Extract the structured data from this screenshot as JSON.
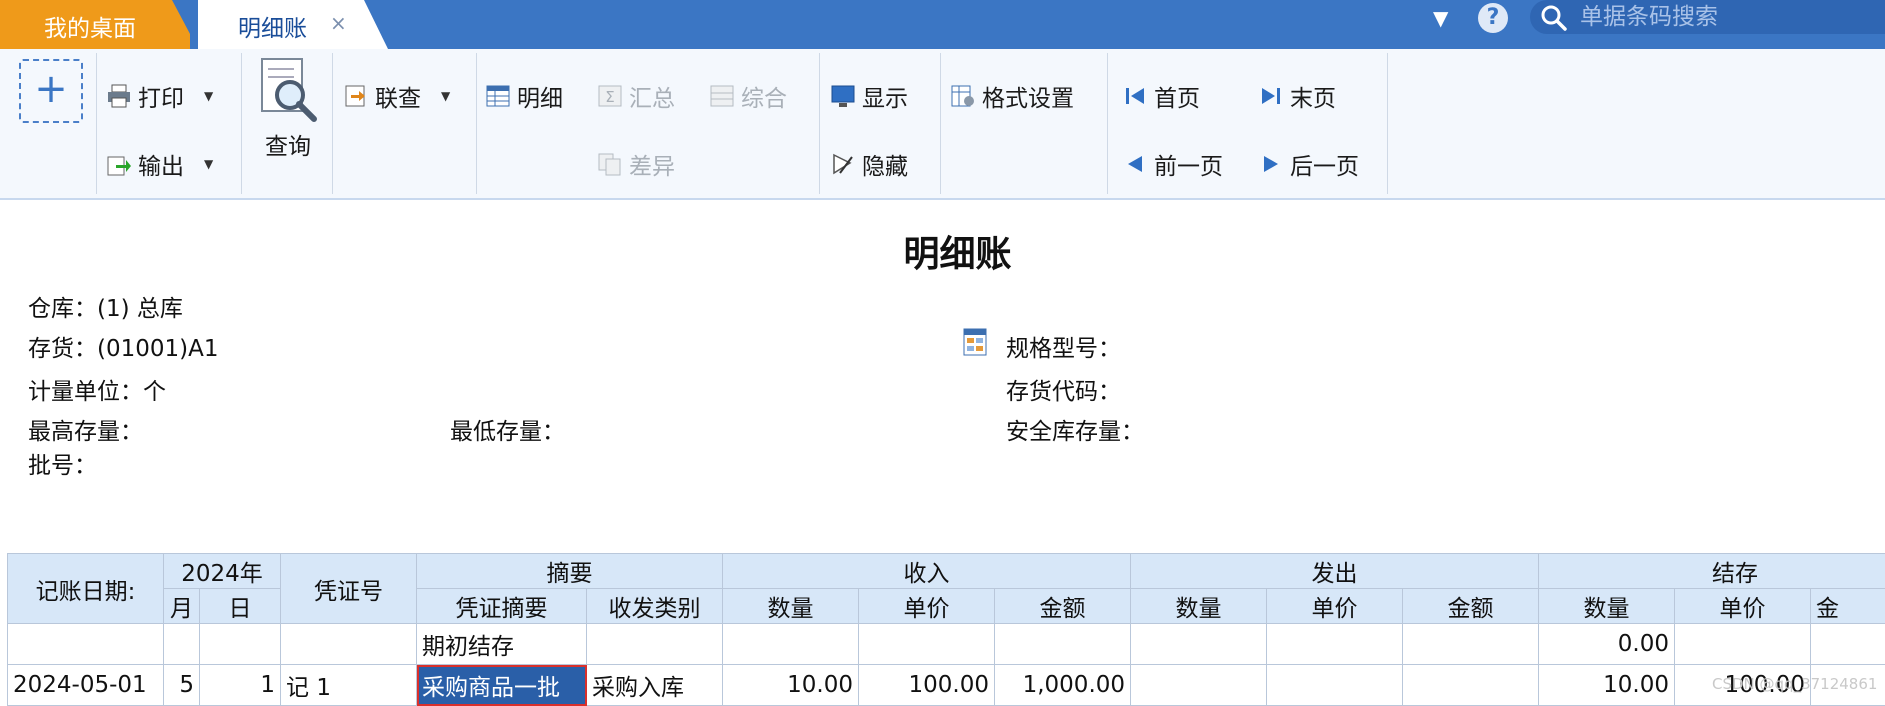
{
  "tabs": {
    "home": "我的桌面",
    "active": "明细账",
    "close": "×"
  },
  "search": {
    "placeholder": "单据条码搜索"
  },
  "help": "?",
  "dropdown": "▼",
  "toolbar": {
    "new": "+",
    "print": "打印",
    "export": "输出",
    "query": "查询",
    "link_query": "联查",
    "detail": "明细",
    "summary": "汇总",
    "comprehensive": "综合",
    "difference": "差异",
    "show": "显示",
    "hide": "隐藏",
    "format": "格式设置",
    "first": "首页",
    "last": "末页",
    "prev": "前一页",
    "next": "后一页"
  },
  "report": {
    "title": "明细账",
    "warehouse": "仓库：(1) 总库",
    "item": "存货：(01001)A1",
    "unit": "计量单位：个",
    "max_stock": "最高存量：",
    "min_stock": "最低存量：",
    "batch": "批号：",
    "spec": "规格型号：",
    "item_code": "存货代码：",
    "safety_stock": "安全库存量："
  },
  "table": {
    "h_date": "记账日期:",
    "h_year": "2024年",
    "h_month": "月",
    "h_day": "日",
    "h_voucher": "凭证号",
    "h_summary": "摘要",
    "h_voucher_summary": "凭证摘要",
    "h_category": "收发类别",
    "h_in": "收入",
    "h_out": "发出",
    "h_balance": "结存",
    "h_qty": "数量",
    "h_price": "单价",
    "h_amount": "金额",
    "h_amount_cut": "金",
    "rows": [
      {
        "date": "",
        "month": "",
        "day": "",
        "voucher": "",
        "summary": "期初结存",
        "category": "",
        "in_qty": "",
        "in_price": "",
        "in_amount": "",
        "out_qty": "",
        "out_price": "",
        "out_amount": "",
        "bal_qty": "0.00",
        "bal_price": "",
        "bal_amount": ""
      },
      {
        "date": "2024-05-01",
        "month": "5",
        "day": "1",
        "voucher": "记 1",
        "summary": "采购商品一批",
        "category": "采购入库",
        "in_qty": "10.00",
        "in_price": "100.00",
        "in_amount": "1,000.00",
        "out_qty": "",
        "out_price": "",
        "out_amount": "",
        "bal_qty": "10.00",
        "bal_price": "100.00",
        "bal_amount": ""
      }
    ]
  },
  "watermark": "CSDN @qq_37124861"
}
